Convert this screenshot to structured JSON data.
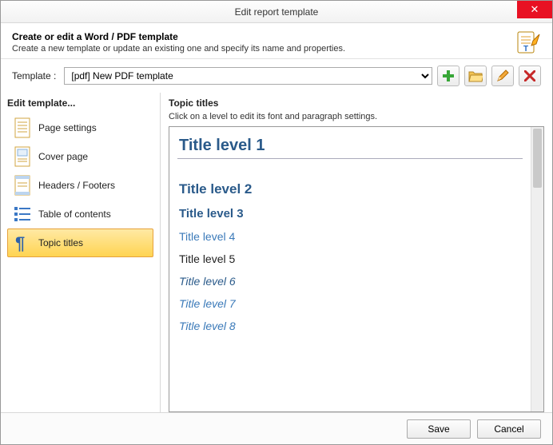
{
  "window": {
    "title": "Edit report template"
  },
  "header": {
    "title": "Create or edit a Word / PDF template",
    "subtitle": "Create a new template or update an existing one and specify its name and properties."
  },
  "template_row": {
    "label": "Template :",
    "selected": "[pdf] New PDF template"
  },
  "left": {
    "heading": "Edit template...",
    "items": [
      {
        "label": "Page settings",
        "icon": "page-icon"
      },
      {
        "label": "Cover page",
        "icon": "cover-icon"
      },
      {
        "label": "Headers / Footers",
        "icon": "header-footer-icon"
      },
      {
        "label": "Table of contents",
        "icon": "toc-icon"
      },
      {
        "label": "Topic titles",
        "icon": "pilcrow-icon"
      }
    ],
    "selected_index": 4
  },
  "right": {
    "heading": "Topic titles",
    "subtitle": "Click on a level to edit its font and paragraph settings.",
    "levels": [
      "Title level 1",
      "Title level 2",
      "Title level 3",
      "Title level 4",
      "Title level 5",
      "Title level 6",
      "Title level 7",
      "Title level 8"
    ]
  },
  "buttons": {
    "save": "Save",
    "cancel": "Cancel"
  }
}
